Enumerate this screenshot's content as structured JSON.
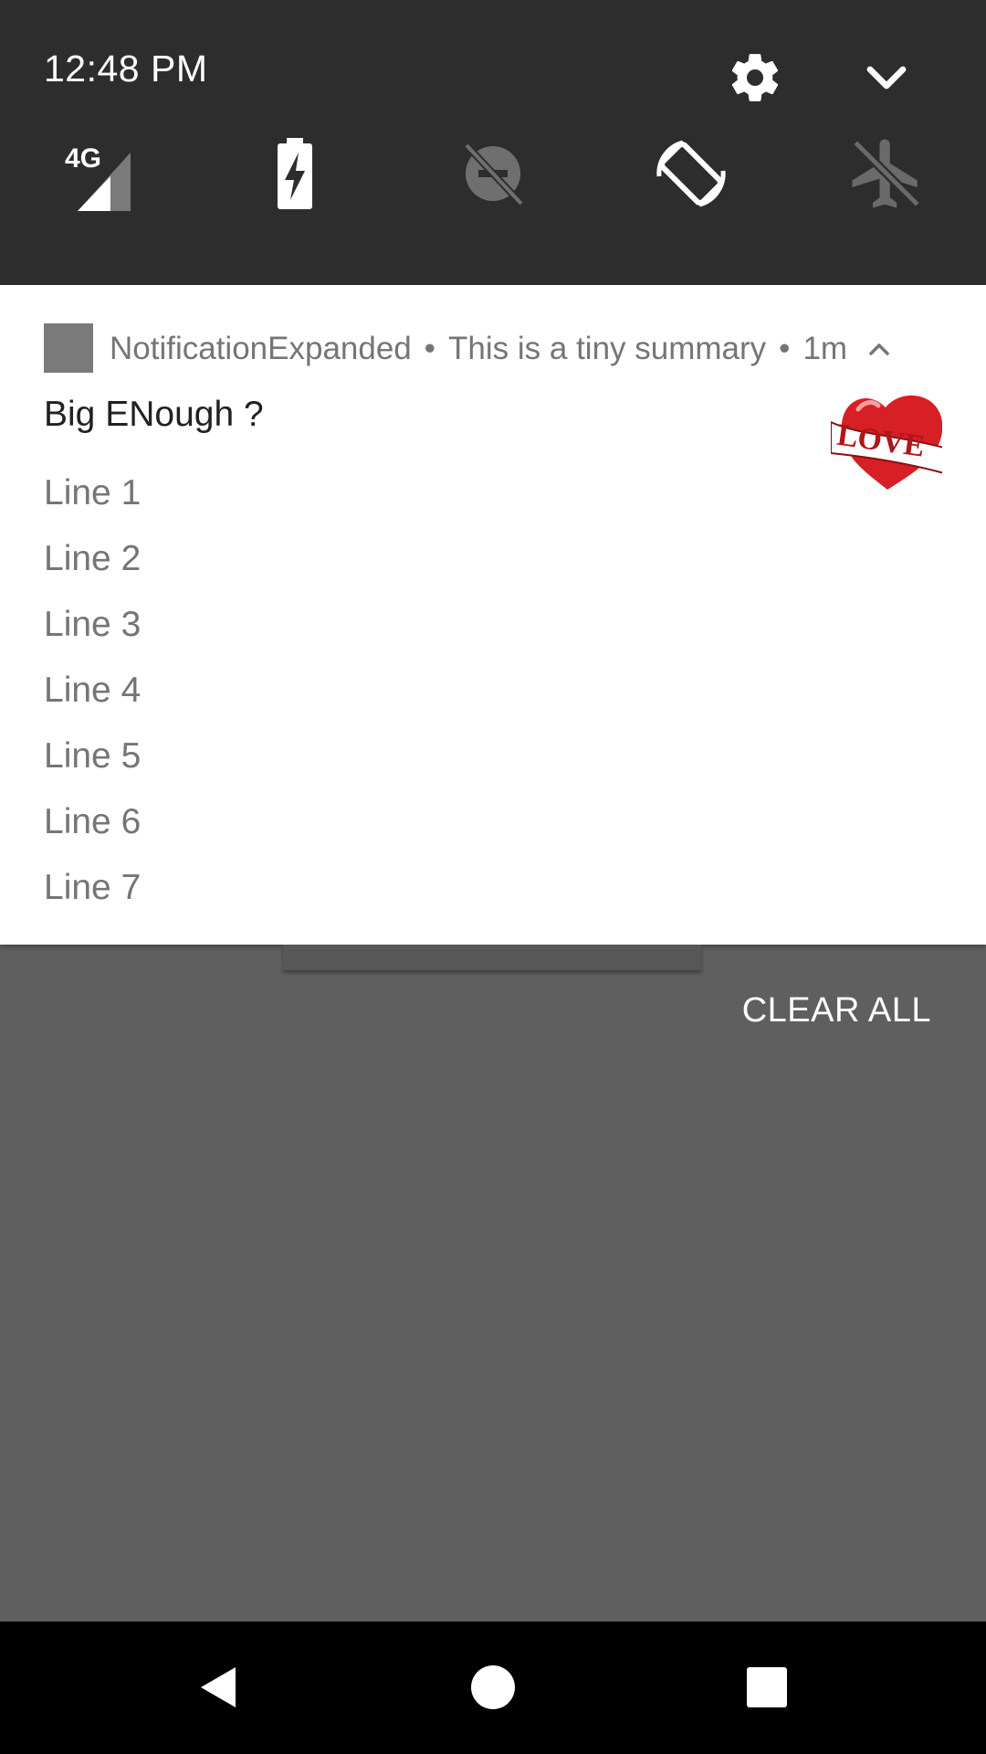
{
  "quick_settings": {
    "time": "12:48 PM",
    "tiles": [
      {
        "name": "mobile-data",
        "icon": "signal-4g-icon",
        "label": "4G"
      },
      {
        "name": "battery-saver",
        "icon": "battery-charging-icon"
      },
      {
        "name": "do-not-disturb",
        "icon": "dnd-off-icon"
      },
      {
        "name": "auto-rotate",
        "icon": "auto-rotate-icon"
      },
      {
        "name": "airplane-mode",
        "icon": "airplane-off-icon"
      }
    ]
  },
  "notification": {
    "app_name": "NotificationExpanded",
    "summary": "This is a tiny summary",
    "time": "1m",
    "separator": "•",
    "title": "Big ENough ?",
    "lines": [
      "Line 1",
      "Line 2",
      "Line 3",
      "Line 4",
      "Line 5",
      "Line 6",
      "Line 7"
    ],
    "large_icon_text": "LOVE"
  },
  "clear_all_label": "CLEAR ALL",
  "colors": {
    "header_bg": "#2d2d2d",
    "shade_bg": "#5f5f5f",
    "heart_red": "#d71f26"
  }
}
